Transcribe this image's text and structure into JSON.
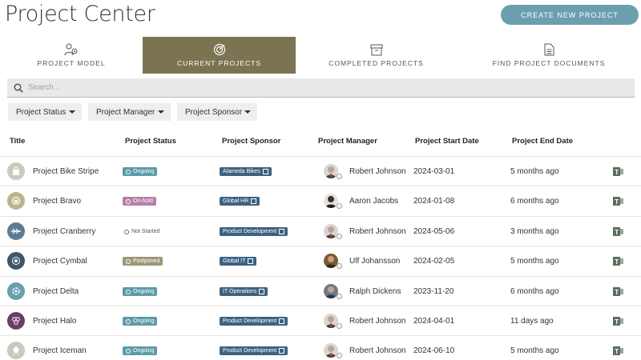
{
  "app": {
    "title": "Project Center",
    "create_button": "CREATE NEW PROJECT"
  },
  "tabs": [
    {
      "label": "PROJECT MODEL",
      "icon": "people-gear-icon",
      "active": false
    },
    {
      "label": "CURRENT PROJECTS",
      "icon": "target-icon",
      "active": true
    },
    {
      "label": "COMPLETED PROJECTS",
      "icon": "archive-box-icon",
      "active": false
    },
    {
      "label": "FIND PROJECT DOCUMENTS",
      "icon": "document-icon",
      "active": false
    }
  ],
  "search": {
    "placeholder": "Search..."
  },
  "filters": [
    {
      "label": "Project Status"
    },
    {
      "label": "Project Manager"
    },
    {
      "label": "Project Sponsor"
    }
  ],
  "columns": [
    "Title",
    "Project Status",
    "Project Sponsor",
    "Project Manager",
    "Project Start Date",
    "Project End Date"
  ],
  "colors": {
    "accent": "#6b9fae",
    "active_tab": "#7b7452",
    "ongoing": "#5d9ba8",
    "onhold": "#b97fa9",
    "postponed": "#9c9878",
    "sponsor_badge": "#3c6280",
    "teams": "#5b6e5f"
  },
  "rows": [
    {
      "title": "Project Bike Stripe",
      "status": "Ongoing",
      "sponsor": "Alameda Bikes",
      "manager": "Robert Johnson",
      "start": "2024-03-01",
      "end": "5 months ago"
    },
    {
      "title": "Project Bravo",
      "status": "On-hold",
      "sponsor": "Global HR",
      "manager": "Aaron Jacobs",
      "start": "2024-01-08",
      "end": "6 months ago"
    },
    {
      "title": "Project Cranberry",
      "status": "Not Started",
      "sponsor": "Product Development",
      "manager": "Robert Johnson",
      "start": "2024-05-06",
      "end": "3 months ago"
    },
    {
      "title": "Project Cymbal",
      "status": "Postponed",
      "sponsor": "Global IT",
      "manager": "Ulf Johansson",
      "start": "2024-02-05",
      "end": "5 months ago"
    },
    {
      "title": "Project Delta",
      "status": "Ongoing",
      "sponsor": "IT Operations",
      "manager": "Ralph Dickens",
      "start": "2023-11-20",
      "end": "6 months ago"
    },
    {
      "title": "Project Halo",
      "status": "Ongoing",
      "sponsor": "Product Development",
      "manager": "Robert Johnson",
      "start": "2024-04-01",
      "end": "11 days ago"
    },
    {
      "title": "Project Iceman",
      "status": "Ongoing",
      "sponsor": "Product Development",
      "manager": "Robert Johnson",
      "start": "2024-06-10",
      "end": "5 months ago"
    }
  ]
}
